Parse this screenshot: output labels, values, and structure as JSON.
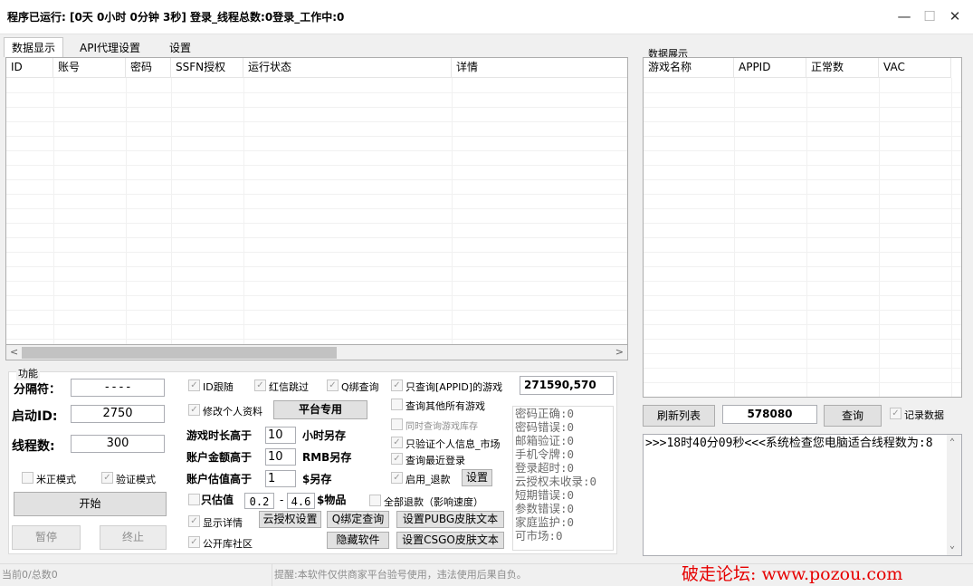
{
  "window": {
    "title": "程序已运行:  [0天 0小时 0分钟 3秒] 登录_线程总数:0登录_工作中:0",
    "minimize": "—",
    "maximize": "☐",
    "close": "✕"
  },
  "tabs": [
    "数据显示",
    "API代理设置",
    "设置"
  ],
  "accounts_table": {
    "columns": [
      "ID",
      "账号",
      "密码",
      "SSFN授权",
      "运行状态",
      "详情"
    ]
  },
  "data_panel": {
    "title": "数据展示",
    "columns": [
      "游戏名称",
      "APPID",
      "正常数",
      "VAC"
    ]
  },
  "functions": {
    "legend": "功能",
    "separator_label": "分隔符：",
    "separator_value": "----",
    "start_id_label": "启动ID:",
    "start_id_value": "2750",
    "threads_label": "线程数:",
    "threads_value": "300",
    "rice_mode": "米正模式",
    "verify_mode": "验证模式",
    "start_button": "开始",
    "pause_button": "暂停",
    "stop_button": "终止"
  },
  "options": {
    "id_follow": "ID跟随",
    "redletter_skip": "红信跳过",
    "q_bind_query": "Q绑查询",
    "only_appid": "只查询[APPID]的游戏",
    "appid_value": "271590,570",
    "modify_profile": "修改个人资料",
    "platform_only": "平台专用",
    "query_others": "查询其他所有游戏",
    "query_inventory": "同时查询游戏库存",
    "verify_market": "只验证个人信息_市场",
    "query_recent_login": "查询最近登录",
    "enable_refund": "启用_退款",
    "settings_button": "设置",
    "playtime_label": "游戏时长高于",
    "playtime_value": "10",
    "playtime_unit": "小时另存",
    "balance_label": "账户金额高于",
    "balance_value": "10",
    "balance_unit": "RMB另存",
    "valuation_label": "账户估值高于",
    "valuation_value": "1",
    "valuation_unit": "$另存",
    "only_value_label": "只估值",
    "range_min": "0.2",
    "range_dash": "-",
    "range_max": "4.6",
    "items_label": "$物品",
    "refund_all": "全部退款（影响速度）",
    "show_details": "显示详情",
    "cloud_auth_settings": "云授权设置",
    "q_bind_lookup": "Q绑定查询",
    "pubg_skin_text": "设置PUBG皮肤文本",
    "public_community": "公开库社区",
    "hide_software": "隐藏软件",
    "csgo_skin_text": "设置CSGO皮肤文本"
  },
  "stats": [
    "密码正确:0",
    "密码错误:0",
    "邮箱验证:0",
    "手机令牌:0",
    "登录超时:0",
    "云授权未收录:0",
    "短期错误:0",
    "参数错误:0",
    "家庭监护:0",
    "可市场:0"
  ],
  "right_controls": {
    "refresh_button": "刷新列表",
    "appid_input": "578080",
    "query_button": "查询",
    "record_data": "记录数据"
  },
  "log": {
    "text": ">>>18时40分09秒<<<系统检查您电脑适合线程数为:8"
  },
  "status_bar": {
    "progress": "当前0/总数0",
    "notice": "提醒:本软件仅供商家平台验号使用，违法使用后果自负。",
    "watermark": "破走论坛: www.pozou.com"
  },
  "colors": {
    "watermark": "#e60000",
    "window_bg": "#f0f0f0",
    "border": "#adadad"
  }
}
